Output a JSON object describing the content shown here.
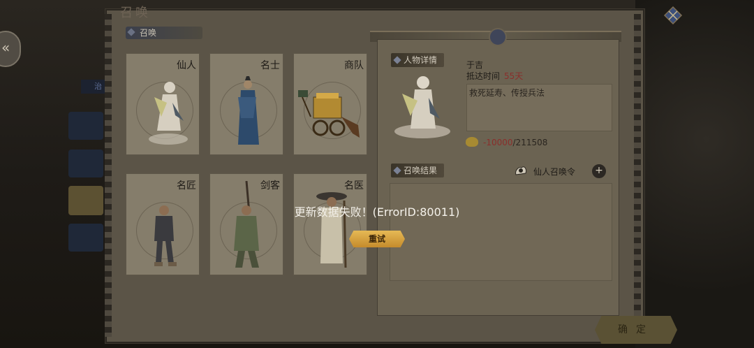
{
  "window": {
    "title": "召唤"
  },
  "summon_tab": {
    "label": "召唤"
  },
  "side_label": "治",
  "cards": [
    {
      "label": "仙人",
      "icon": "immortal-figure-icon"
    },
    {
      "label": "名士",
      "icon": "scholar-figure-icon"
    },
    {
      "label": "商队",
      "icon": "caravan-cart-icon"
    },
    {
      "label": "名匠",
      "icon": "craftsman-figure-icon"
    },
    {
      "label": "剑客",
      "icon": "swordsman-figure-icon"
    },
    {
      "label": "名医",
      "icon": "doctor-figure-icon"
    }
  ],
  "detail": {
    "header": "人物详情",
    "name": "于吉",
    "arrive_label": "抵达时间",
    "arrive_days": "55天",
    "description": "救死延寿、传授兵法",
    "cost_negative": "-10000",
    "cost_total": "/211508"
  },
  "results": {
    "header": "召唤结果",
    "token_label": "仙人召唤令",
    "plus_label": "+"
  },
  "modal": {
    "message": "更新数据失败！(ErrorID:80011)",
    "retry_label": "重试"
  },
  "confirm_label": "确定",
  "colors": {
    "error_red": "#8a2e2b",
    "gold": "#e6b955"
  }
}
